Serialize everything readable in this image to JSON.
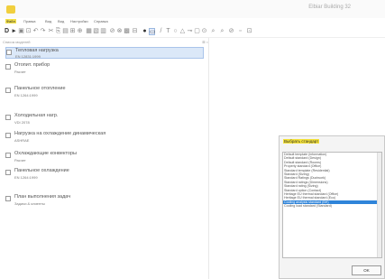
{
  "window": {
    "title": "Elbiar Building 32"
  },
  "menu": {
    "items": [
      {
        "label": "Файл"
      },
      {
        "label": "Правка"
      },
      {
        "label": "Вид"
      },
      {
        "label": "Вид"
      },
      {
        "label": "Настройки"
      },
      {
        "label": "Справка"
      }
    ]
  },
  "toolbar": {
    "icons": [
      "new-file-icon",
      "open-icon",
      "save-icon",
      "undo-icon",
      "redo-icon",
      "cut-icon",
      "copy-icon",
      "paste-icon",
      "delete-icon",
      "print-icon",
      "grid-icon",
      "layers-icon",
      "text-icon",
      "align-icon",
      "bullet-icon",
      "select-icon",
      "line-icon",
      "text-tool-icon",
      "circle-icon",
      "rect-icon",
      "arrow-icon",
      "zoom-icon",
      "hand-icon",
      "zoom-in-icon",
      "zoom-out-icon",
      "fit-icon",
      "settings-icon"
    ]
  },
  "panel": {
    "header": "Список моделей",
    "close": "⊠ ×"
  },
  "tree": [
    {
      "title": "Тепловая нагрузка",
      "subtitle": "EN 12831:1999",
      "selected": true
    },
    {
      "title": "Отопит. прибор",
      "subtitle": "Расчет"
    },
    {
      "title": "Панельное отопление",
      "subtitle": "EN 1264:1999"
    },
    {
      "title": "Холодильная нагр.",
      "subtitle": "VDI 2078"
    },
    {
      "title": "Нагрузка на охлаждение динамическая",
      "subtitle": "ASHRAE"
    },
    {
      "title": "Охлаждающие конвекторы",
      "subtitle": "Расчет"
    },
    {
      "title": "Панельное охлаждение",
      "subtitle": "EN 1264:1999"
    },
    {
      "title": "План выполнения задач",
      "subtitle": "Задачи & клиенты"
    }
  ],
  "dialog": {
    "title": "Выбрать стандарт",
    "options": [
      "Default template (information)",
      "Default standard (Design)",
      "Default standard (Rooms)",
      "Property standard (Office)",
      "Standard template (Residential)",
      "Standard (Sizing)",
      "Standard Ratings (Ductwork)",
      "Standard ratings (Dimensions)",
      "Standard rating (Sizing)",
      "Standard option (Contact)",
      "Heritage EU thermal standard (Office)",
      "Heritage EU thermal standard (Eco)",
      "Cooling analysis standard (BH)",
      "Cooling load standard (Standard)"
    ],
    "selected_index": 12,
    "ok_label": "OK"
  }
}
